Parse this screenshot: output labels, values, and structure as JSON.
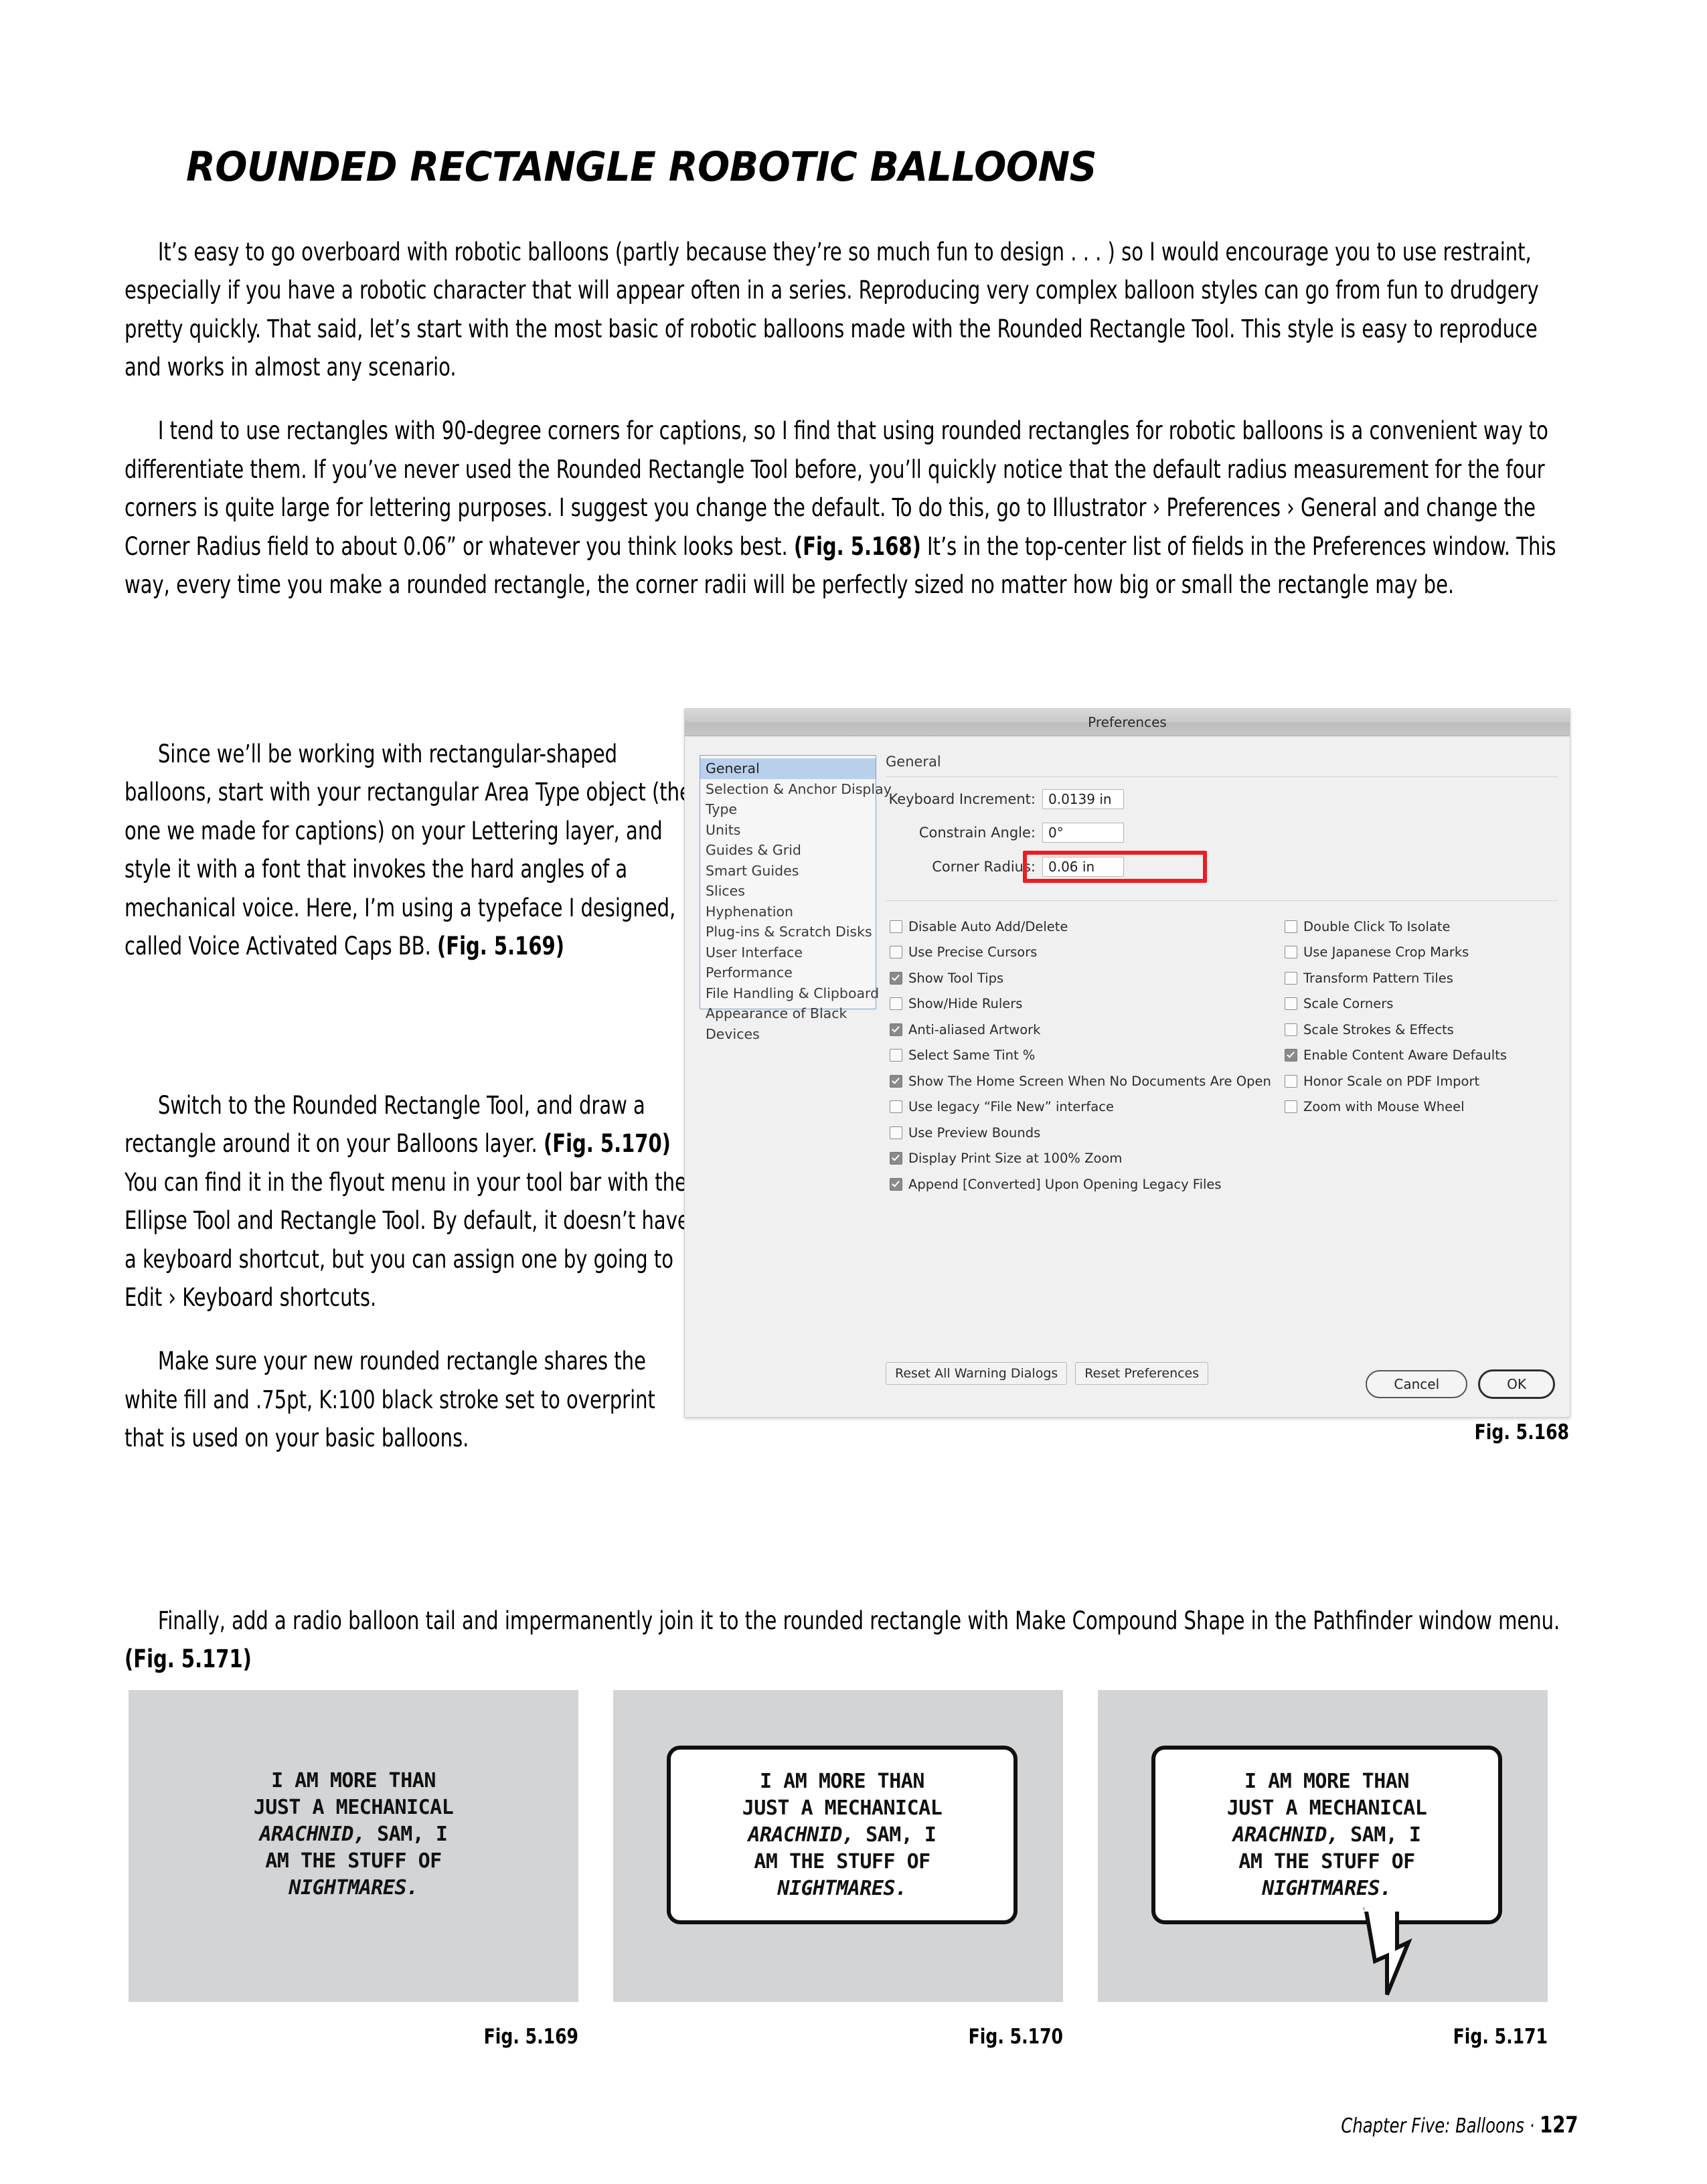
{
  "heading": "ROUNDED RECTANGLE ROBOTIC BALLOONS",
  "intro": {
    "p1_a": "It’s easy to go overboard with robotic balloons (partly because they’re so much fun to design . . . ) so I would encourage you to use restraint, especially if you have a robotic character that will appear often in a series. Reproducing very complex balloon styles can go from fun to drudgery pretty quickly. That said, let’s start with the most basic of robotic balloons made with the Rounded Rectangle Tool. This style is easy to reproduce and works in almost any scenario.",
    "p2_a": "I tend to use rectangles with 90-degree corners for captions, so I find that using rounded rectangles for robotic balloons is a convenient way to differentiate them. If you’ve never used the Rounded Rectangle Tool before, you’ll quickly notice that the default radius measurement for the four corners is quite large for lettering purposes. I suggest you change the default. To do this, go to Illustrator › Preferences › General and change the Corner Radius field to about 0.06” or whatever you think looks best. ",
    "p2_ref": "(Fig. 5.168)",
    "p2_b": " It’s in the top-center list of fields in the Preferences window. This way, every time you make a rounded rectangle, the corner radii will be perfectly sized no matter how big or small the rectangle may be."
  },
  "left_column": {
    "p3_a": "Since we’ll be working with rectangular-shaped balloons, start with your rectangular Area Type object (the one we made for captions) on your Lettering layer, and style it with a font that invokes the hard angles of a mechanical voice. Here, I’m using a typeface I designed, called Voice Activated Caps BB. ",
    "p3_ref": "(Fig. 5.169)",
    "p4_a": "Switch to the Rounded Rectangle Tool, and draw a rectangle around it on your Balloons layer. ",
    "p4_ref": "(Fig. 5.170)",
    "p4_b": " You can find it in the flyout menu in your tool bar with the Ellipse Tool and Rectangle Tool. By default, it doesn’t have a keyboard shortcut, but you can assign one by going to Edit › Keyboard shortcuts.",
    "p5": "Make sure your new rounded rectangle shares the white fill and .75pt, K:100 black stroke set to overprint that is used on your basic balloons."
  },
  "final_paragraph": {
    "a": "Finally, add a radio balloon tail and impermanently join it to the rounded rectangle with Make Compound Shape in the Pathfinder window menu. ",
    "ref": "(Fig. 5.171)"
  },
  "dialog": {
    "title": "Preferences",
    "panel_title": "General",
    "sidebar": [
      {
        "label": "General",
        "selected": true
      },
      {
        "label": "Selection & Anchor Display",
        "selected": false
      },
      {
        "label": "Type",
        "selected": false
      },
      {
        "label": "Units",
        "selected": false
      },
      {
        "label": "Guides & Grid",
        "selected": false
      },
      {
        "label": "Smart Guides",
        "selected": false
      },
      {
        "label": "Slices",
        "selected": false
      },
      {
        "label": "Hyphenation",
        "selected": false
      },
      {
        "label": "Plug-ins & Scratch Disks",
        "selected": false
      },
      {
        "label": "User Interface",
        "selected": false
      },
      {
        "label": "Performance",
        "selected": false
      },
      {
        "label": "File Handling & Clipboard",
        "selected": false
      },
      {
        "label": "Appearance of Black",
        "selected": false
      },
      {
        "label": "Devices",
        "selected": false
      }
    ],
    "fields": [
      {
        "label": "Keyboard Increment:",
        "value": "0.0139 in"
      },
      {
        "label": "Constrain Angle:",
        "value": "0°"
      },
      {
        "label": "Corner Radius:",
        "value": "0.06 in"
      }
    ],
    "highlight_color": "#ee1b24",
    "checkboxes_left": [
      {
        "label": "Disable Auto Add/Delete",
        "checked": false
      },
      {
        "label": "Use Precise Cursors",
        "checked": false
      },
      {
        "label": "Show Tool Tips",
        "checked": true
      },
      {
        "label": "Show/Hide Rulers",
        "checked": false
      },
      {
        "label": "Anti-aliased Artwork",
        "checked": true
      },
      {
        "label": "Select Same Tint %",
        "checked": false
      },
      {
        "label": "Show The Home Screen When No Documents Are Open",
        "checked": true
      },
      {
        "label": "Use legacy “File New” interface",
        "checked": false
      },
      {
        "label": "Use Preview Bounds",
        "checked": false
      },
      {
        "label": "Display Print Size at 100% Zoom",
        "checked": true
      },
      {
        "label": "Append [Converted] Upon Opening Legacy Files",
        "checked": true
      }
    ],
    "checkboxes_right": [
      {
        "label": "Double Click To Isolate",
        "checked": false
      },
      {
        "label": "Use Japanese Crop Marks",
        "checked": false
      },
      {
        "label": "Transform Pattern Tiles",
        "checked": false
      },
      {
        "label": "Scale Corners",
        "checked": false
      },
      {
        "label": "Scale Strokes & Effects",
        "checked": false
      },
      {
        "label": "Enable Content Aware Defaults",
        "checked": true
      },
      {
        "label": "Honor Scale on PDF Import",
        "checked": false
      },
      {
        "label": "Zoom with Mouse Wheel",
        "checked": false
      }
    ],
    "reset_all_warning_dialogs": "Reset All Warning Dialogs",
    "reset_preferences": "Reset Preferences",
    "cancel": "Cancel",
    "ok": "OK"
  },
  "balloon_lines": [
    {
      "text": "I AM MORE THAN",
      "em": false
    },
    {
      "text": "JUST A MECHANICAL",
      "em": false
    },
    {
      "text": "ARACHNID,",
      "em": true,
      "tail": " SAM, I"
    },
    {
      "text": "AM THE STUFF OF",
      "em": false
    },
    {
      "text": "NIGHTMARES.",
      "em": true
    }
  ],
  "captions": {
    "fig_5168": "Fig. 5.168",
    "fig_5169": "Fig. 5.169",
    "fig_5170": "Fig. 5.170",
    "fig_5171": "Fig. 5.171"
  },
  "footer": {
    "chapter": "Chapter Five: Balloons · ",
    "page": "127"
  }
}
